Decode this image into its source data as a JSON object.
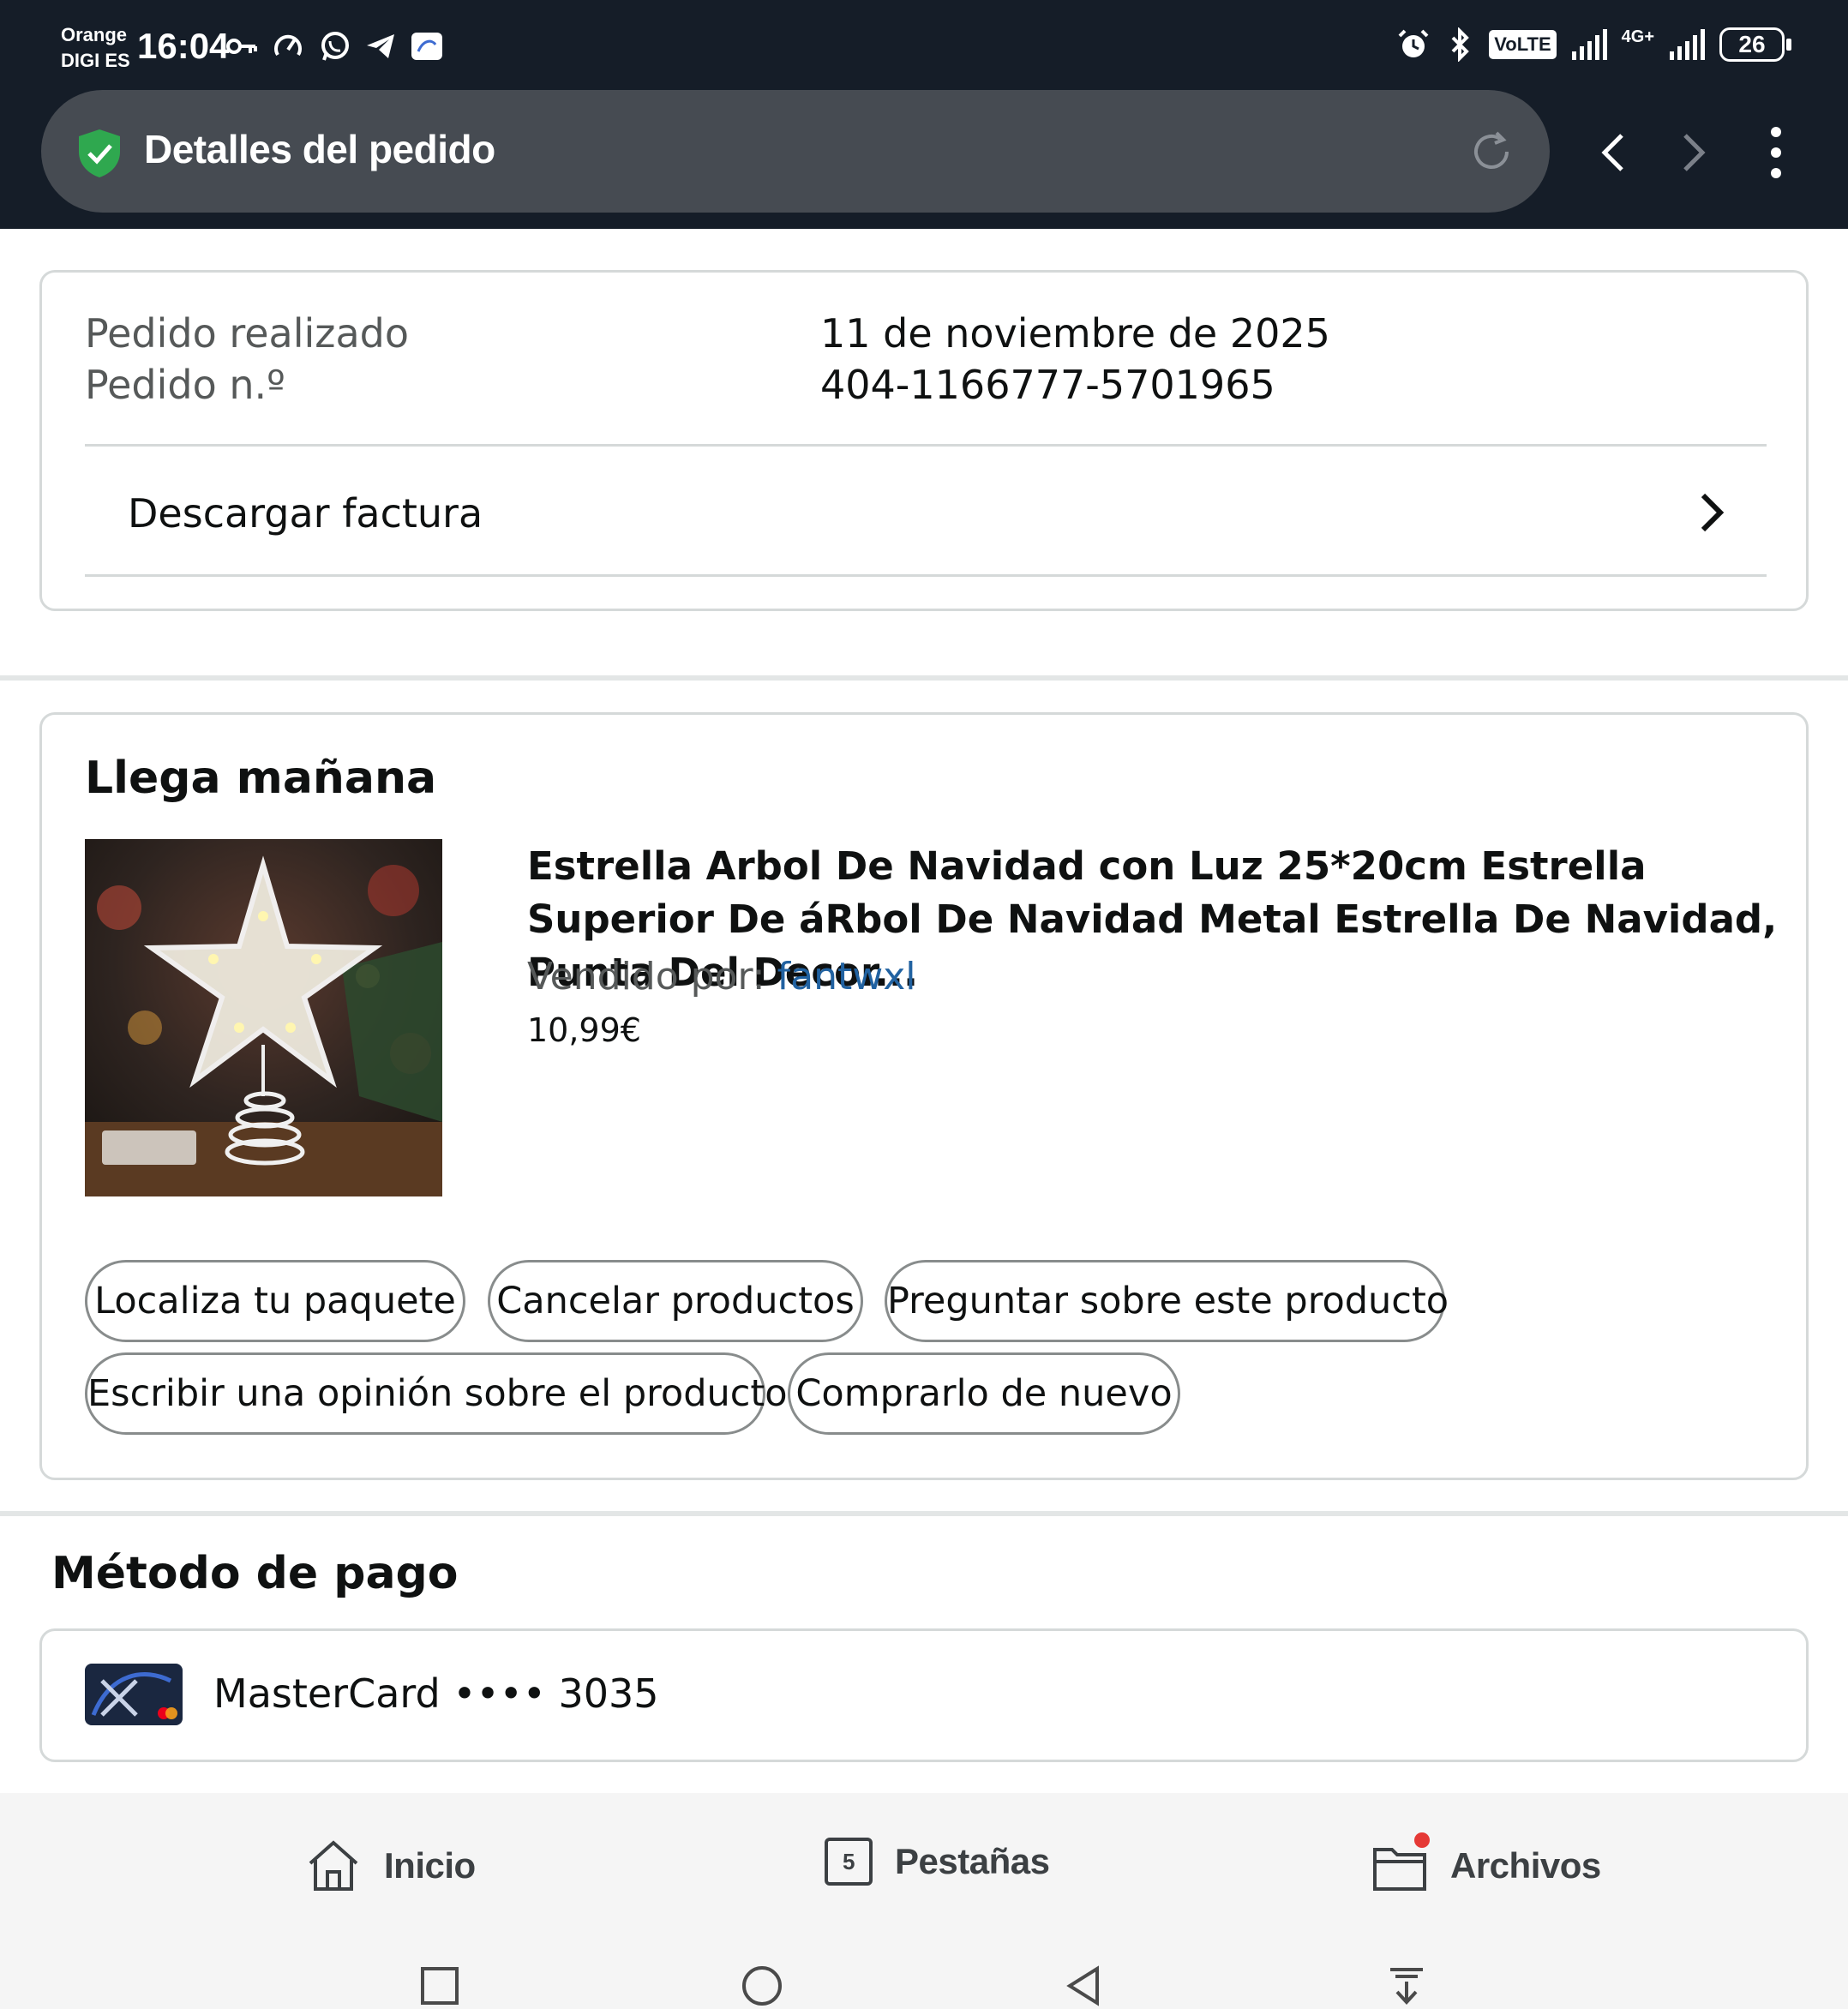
{
  "status_bar": {
    "carrier_line1": "Orange",
    "carrier_line2": "DIGI ES",
    "time": "16:04",
    "network": "4G+",
    "volte": "VoLTE",
    "battery": "26"
  },
  "browser": {
    "page_title": "Detalles del pedido"
  },
  "order_summary": {
    "placed_label": "Pedido realizado",
    "placed_value": "11 de noviembre de 2025",
    "number_label": "Pedido n.º",
    "number_value": "404-1166777-5701965",
    "invoice_label": "Descargar factura"
  },
  "shipment": {
    "heading": "Llega mañana",
    "product_title": "Estrella Arbol De Navidad con Luz 25*20cm Estrella Superior De áRbol De Navidad Metal Estrella De Navidad, Punta Del Decor...",
    "seller_label": "Vendido por:",
    "seller_name": "fantwxl",
    "price": "10,99€",
    "actions": [
      "Localiza tu paquete",
      "Cancelar productos",
      "Preguntar sobre este producto",
      "Escribir una opinión sobre el producto",
      "Comprarlo de nuevo"
    ]
  },
  "payment": {
    "heading": "Método de pago",
    "card_text": "MasterCard •••• 3035"
  },
  "bottom_nav": {
    "home": "Inicio",
    "tabs": "Pestañas",
    "tabs_count": "5",
    "files": "Archivos"
  },
  "colors": {
    "header_bg": "#151d28",
    "url_bar_bg": "#464b52",
    "link": "#2162a1",
    "border": "#d5d9d9"
  }
}
